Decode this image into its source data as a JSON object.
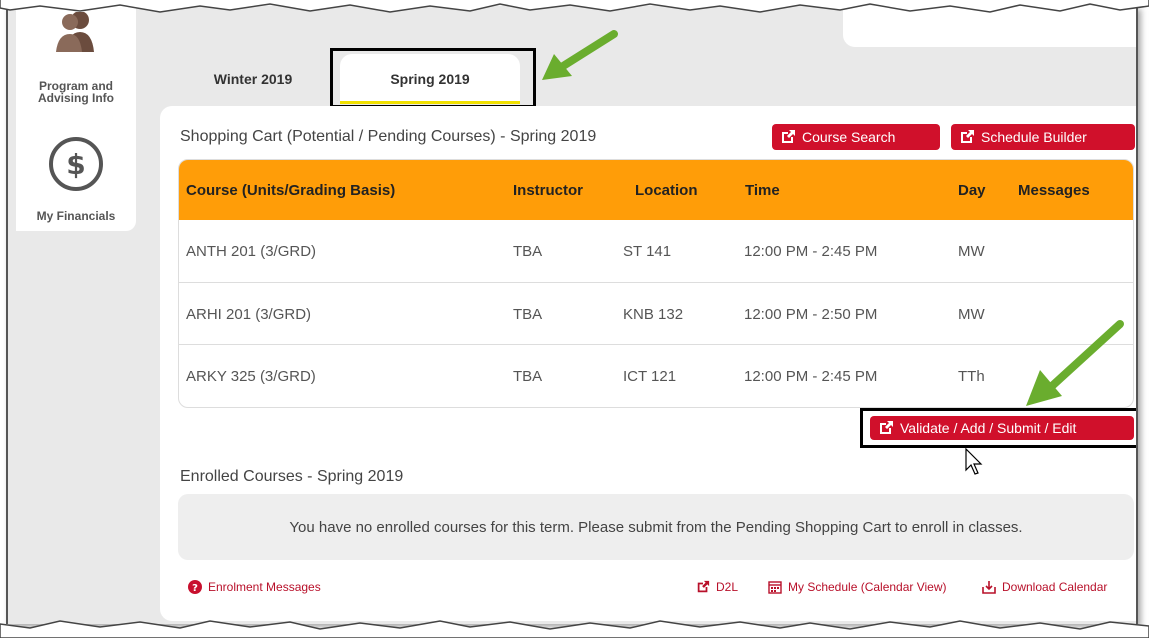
{
  "sidebar": {
    "items": [
      {
        "label_line1": "Program and",
        "label_line2": "Advising Info",
        "icon": "people-icon"
      },
      {
        "label_line1": "My Financials",
        "icon": "dollar-circle-icon"
      }
    ]
  },
  "tabs": [
    {
      "label": "Winter 2019",
      "active": false
    },
    {
      "label": "Spring 2019",
      "active": true
    }
  ],
  "cart": {
    "title": "Shopping Cart (Potential / Pending Courses) - Spring 2019",
    "course_search_label": "Course Search",
    "schedule_builder_label": "Schedule Builder",
    "columns": [
      "Course (Units/Grading Basis)",
      "Instructor",
      "Location",
      "Time",
      "Day",
      "Messages"
    ],
    "rows": [
      {
        "course": "ANTH 201 (3/GRD)",
        "instructor": "TBA",
        "location": "ST 141",
        "time": "12:00 PM - 2:45 PM",
        "day": "MW",
        "messages": ""
      },
      {
        "course": "ARHI 201 (3/GRD)",
        "instructor": "TBA",
        "location": "KNB 132",
        "time": "12:00 PM - 2:50 PM",
        "day": "MW",
        "messages": ""
      },
      {
        "course": "ARKY 325 (3/GRD)",
        "instructor": "TBA",
        "location": "ICT 121",
        "time": "12:00 PM - 2:45 PM",
        "day": "TTh",
        "messages": ""
      }
    ],
    "validate_label": "Validate / Add / Submit / Edit"
  },
  "enrolled": {
    "title": "Enrolled Courses - Spring 2019",
    "empty_message": "You have no enrolled courses for this term. Please submit from the Pending Shopping Cart to enroll in classes."
  },
  "footer": {
    "enrolment_messages": "Enrolment Messages",
    "d2l": "D2L",
    "my_schedule": "My Schedule (Calendar View)",
    "download_calendar": "Download Calendar"
  },
  "colors": {
    "accent_red": "#d0102b",
    "header_orange": "#ff9d08",
    "annotation_green": "#6aad2e"
  }
}
